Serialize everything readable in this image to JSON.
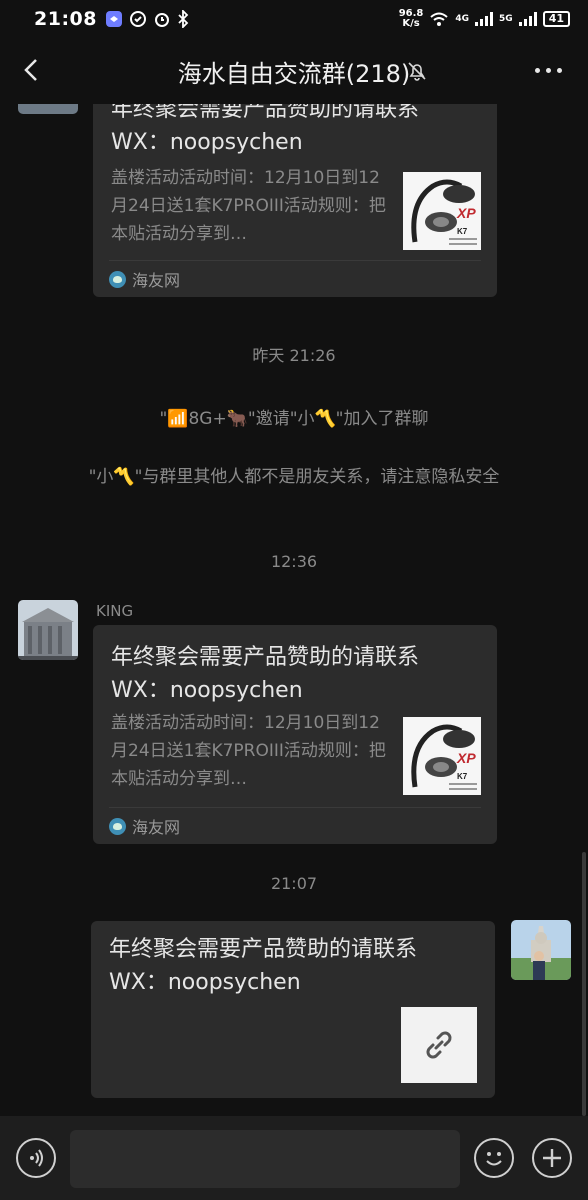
{
  "status_bar": {
    "time": "21:08",
    "net_speed_value": "96.8",
    "net_speed_unit": "K/s",
    "signal1_label": "4G",
    "signal2_label": "5G",
    "battery": "41"
  },
  "header": {
    "title": "海水自由交流群(218)"
  },
  "messages": {
    "card1": {
      "title_line1": "年终聚会需要产品赞助的请联系",
      "title_line2": "WX：noopsychen",
      "desc": "盖楼活动活动时间：12月10日到12月24日送1套K7PROIII活动规则：把本贴活动分享到…",
      "source": "海友网"
    },
    "time1": "昨天 21:26",
    "sys1": "\"📶8G+🐂\"邀请\"小〽️\"加入了群聊",
    "sys2": "\"小〽️\"与群里其他人都不是朋友关系，请注意隐私安全",
    "time2": "12:36",
    "card2": {
      "sender": "KING",
      "title_line1": "年终聚会需要产品赞助的请联系",
      "title_line2": "WX：noopsychen",
      "desc": "盖楼活动活动时间：12月10日到12月24日送1套K7PROIII活动规则：把本贴活动分享到…",
      "source": "海友网"
    },
    "time3": "21:07",
    "card3": {
      "title_line1": "年终聚会需要产品赞助的请联系",
      "title_line2": "WX：noopsychen"
    }
  },
  "thumb_text": "K7",
  "colors": {
    "background": "#111111",
    "bubble": "#2c2c2c",
    "muted_text": "#8a8a8a"
  }
}
